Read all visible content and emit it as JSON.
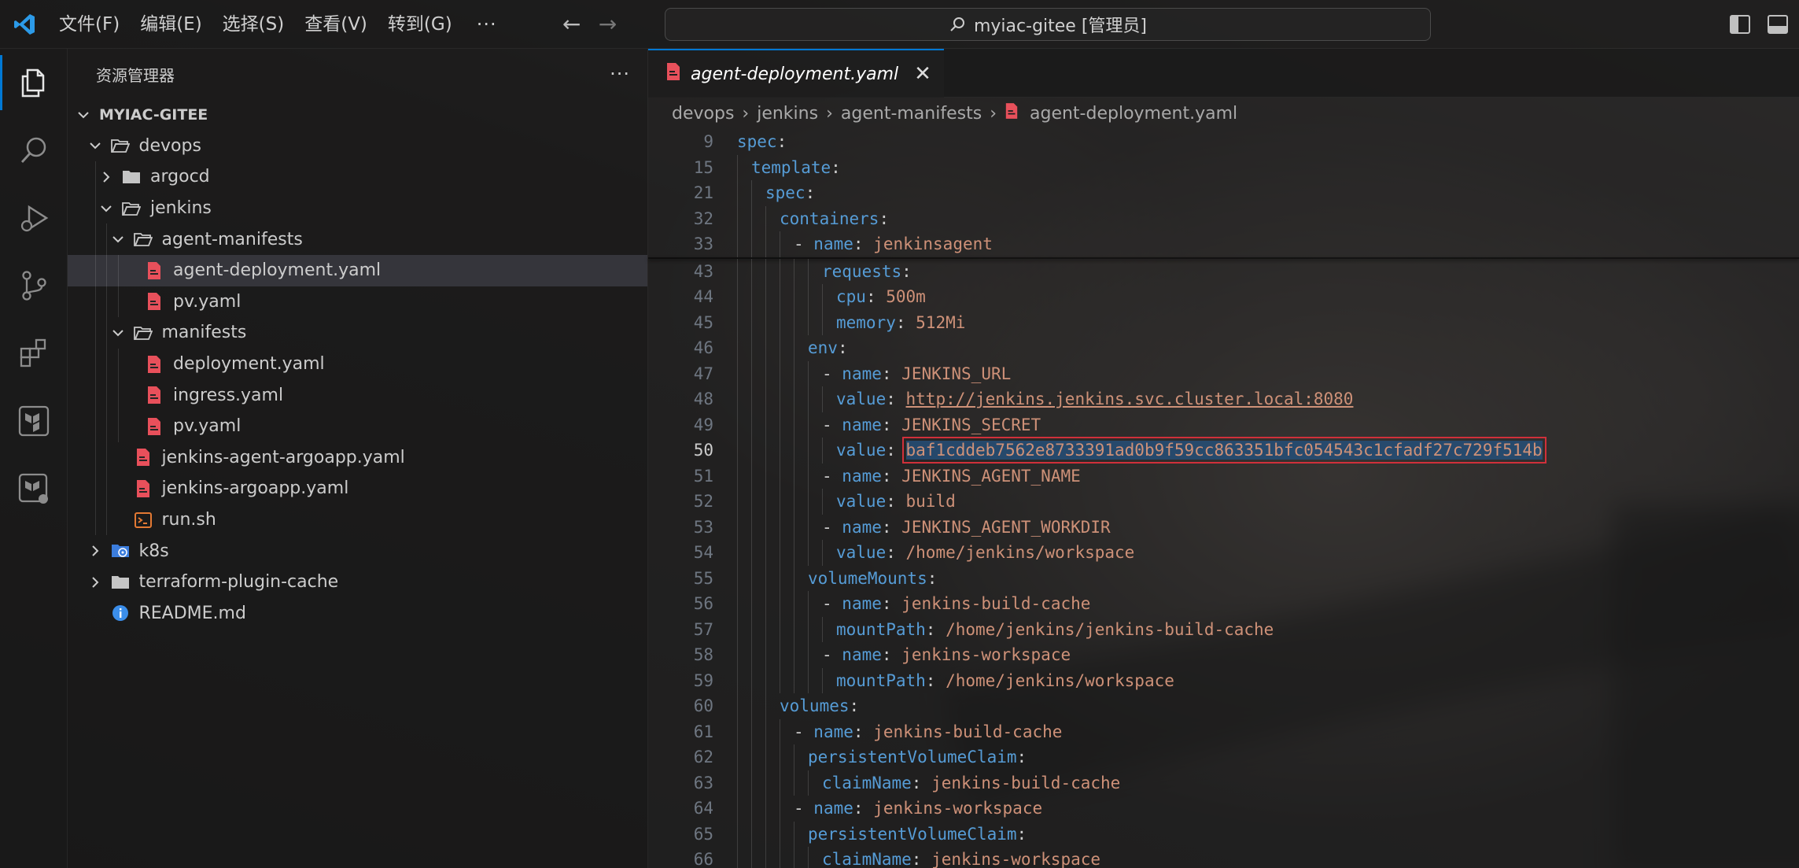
{
  "titlebar": {
    "menus": [
      "文件(F)",
      "编辑(E)",
      "选择(S)",
      "查看(V)",
      "转到(G)"
    ],
    "more": "···",
    "command_center": "myiac-gitee [管理员]"
  },
  "activitybar": {
    "items": [
      "explorer-icon",
      "search-icon",
      "run-debug-icon",
      "source-control-icon",
      "extensions-icon",
      "terraform-icon",
      "terraform-cloud-icon"
    ]
  },
  "sidebar": {
    "title": "资源管理器",
    "more": "···",
    "root": "MYIAC-GITEE",
    "tree": [
      {
        "label": "devops",
        "type": "folder-open",
        "depth": 1
      },
      {
        "label": "argocd",
        "type": "folder",
        "depth": 2
      },
      {
        "label": "jenkins",
        "type": "folder-open",
        "depth": 2
      },
      {
        "label": "agent-manifests",
        "type": "folder-open",
        "depth": 3
      },
      {
        "label": "agent-deployment.yaml",
        "type": "yaml",
        "depth": 4,
        "selected": true
      },
      {
        "label": "pv.yaml",
        "type": "yaml",
        "depth": 4
      },
      {
        "label": "manifests",
        "type": "folder-open",
        "depth": 3
      },
      {
        "label": "deployment.yaml",
        "type": "yaml",
        "depth": 4
      },
      {
        "label": "ingress.yaml",
        "type": "yaml",
        "depth": 4
      },
      {
        "label": "pv.yaml",
        "type": "yaml",
        "depth": 4
      },
      {
        "label": "jenkins-agent-argoapp.yaml",
        "type": "yaml",
        "depth": 3
      },
      {
        "label": "jenkins-argoapp.yaml",
        "type": "yaml",
        "depth": 3
      },
      {
        "label": "run.sh",
        "type": "shell",
        "depth": 3
      },
      {
        "label": "k8s",
        "type": "k8s-folder",
        "depth": 1
      },
      {
        "label": "terraform-plugin-cache",
        "type": "folder",
        "depth": 1
      },
      {
        "label": "README.md",
        "type": "info",
        "depth": 1
      }
    ]
  },
  "editor": {
    "tab": {
      "label": "agent-deployment.yaml",
      "close": "✕"
    },
    "breadcrumb": [
      "devops",
      "jenkins",
      "agent-manifests",
      "agent-deployment.yaml"
    ],
    "sticky_lines": [
      {
        "n": "9",
        "indent": 0,
        "tokens": [
          [
            "k",
            "spec"
          ],
          [
            "p",
            ":"
          ]
        ]
      },
      {
        "n": "15",
        "indent": 1,
        "tokens": [
          [
            "k",
            "template"
          ],
          [
            "p",
            ":"
          ]
        ]
      },
      {
        "n": "21",
        "indent": 2,
        "tokens": [
          [
            "k",
            "spec"
          ],
          [
            "p",
            ":"
          ]
        ]
      },
      {
        "n": "32",
        "indent": 3,
        "tokens": [
          [
            "k",
            "containers"
          ],
          [
            "p",
            ":"
          ]
        ]
      },
      {
        "n": "33",
        "indent": 4,
        "tokens": [
          [
            "p",
            "- "
          ],
          [
            "k",
            "name"
          ],
          [
            "p",
            ": "
          ],
          [
            "s",
            "jenkinsagent"
          ]
        ]
      }
    ],
    "lines": [
      {
        "n": "43",
        "indent": 6,
        "tokens": [
          [
            "k",
            "requests"
          ],
          [
            "p",
            ":"
          ]
        ]
      },
      {
        "n": "44",
        "indent": 7,
        "tokens": [
          [
            "k",
            "cpu"
          ],
          [
            "p",
            ": "
          ],
          [
            "s",
            "500m"
          ]
        ]
      },
      {
        "n": "45",
        "indent": 7,
        "tokens": [
          [
            "k",
            "memory"
          ],
          [
            "p",
            ": "
          ],
          [
            "s",
            "512Mi"
          ]
        ]
      },
      {
        "n": "46",
        "indent": 5,
        "tokens": [
          [
            "k",
            "env"
          ],
          [
            "p",
            ":"
          ]
        ]
      },
      {
        "n": "47",
        "indent": 6,
        "tokens": [
          [
            "p",
            "- "
          ],
          [
            "k",
            "name"
          ],
          [
            "p",
            ": "
          ],
          [
            "s",
            "JENKINS_URL"
          ]
        ]
      },
      {
        "n": "48",
        "indent": 7,
        "tokens": [
          [
            "k",
            "value"
          ],
          [
            "p",
            ": "
          ],
          [
            "link",
            "http://jenkins.jenkins.svc.cluster.local:8080"
          ]
        ]
      },
      {
        "n": "49",
        "indent": 6,
        "tokens": [
          [
            "p",
            "- "
          ],
          [
            "k",
            "name"
          ],
          [
            "p",
            ": "
          ],
          [
            "s",
            "JENKINS_SECRET"
          ]
        ]
      },
      {
        "n": "50",
        "indent": 7,
        "current": true,
        "tokens": [
          [
            "k",
            "value"
          ],
          [
            "p",
            ": "
          ],
          [
            "hl",
            "baf1cddeb7562e8733391ad0b9f59cc863351bfc054543c1cfadf27c729f514b"
          ]
        ]
      },
      {
        "n": "51",
        "indent": 6,
        "tokens": [
          [
            "p",
            "- "
          ],
          [
            "k",
            "name"
          ],
          [
            "p",
            ": "
          ],
          [
            "s",
            "JENKINS_AGENT_NAME"
          ]
        ]
      },
      {
        "n": "52",
        "indent": 7,
        "tokens": [
          [
            "k",
            "value"
          ],
          [
            "p",
            ": "
          ],
          [
            "s",
            "build"
          ]
        ]
      },
      {
        "n": "53",
        "indent": 6,
        "tokens": [
          [
            "p",
            "- "
          ],
          [
            "k",
            "name"
          ],
          [
            "p",
            ": "
          ],
          [
            "s",
            "JENKINS_AGENT_WORKDIR"
          ]
        ]
      },
      {
        "n": "54",
        "indent": 7,
        "tokens": [
          [
            "k",
            "value"
          ],
          [
            "p",
            ": "
          ],
          [
            "s",
            "/home/jenkins/workspace"
          ]
        ]
      },
      {
        "n": "55",
        "indent": 5,
        "tokens": [
          [
            "k",
            "volumeMounts"
          ],
          [
            "p",
            ":"
          ]
        ]
      },
      {
        "n": "56",
        "indent": 6,
        "tokens": [
          [
            "p",
            "- "
          ],
          [
            "k",
            "name"
          ],
          [
            "p",
            ": "
          ],
          [
            "s",
            "jenkins-build-cache"
          ]
        ]
      },
      {
        "n": "57",
        "indent": 7,
        "tokens": [
          [
            "k",
            "mountPath"
          ],
          [
            "p",
            ": "
          ],
          [
            "s",
            "/home/jenkins/jenkins-build-cache"
          ]
        ]
      },
      {
        "n": "58",
        "indent": 6,
        "tokens": [
          [
            "p",
            "- "
          ],
          [
            "k",
            "name"
          ],
          [
            "p",
            ": "
          ],
          [
            "s",
            "jenkins-workspace"
          ]
        ]
      },
      {
        "n": "59",
        "indent": 7,
        "tokens": [
          [
            "k",
            "mountPath"
          ],
          [
            "p",
            ": "
          ],
          [
            "s",
            "/home/jenkins/workspace"
          ]
        ]
      },
      {
        "n": "60",
        "indent": 3,
        "tokens": [
          [
            "k",
            "volumes"
          ],
          [
            "p",
            ":"
          ]
        ]
      },
      {
        "n": "61",
        "indent": 4,
        "tokens": [
          [
            "p",
            "- "
          ],
          [
            "k",
            "name"
          ],
          [
            "p",
            ": "
          ],
          [
            "s",
            "jenkins-build-cache"
          ]
        ]
      },
      {
        "n": "62",
        "indent": 5,
        "tokens": [
          [
            "k",
            "persistentVolumeClaim"
          ],
          [
            "p",
            ":"
          ]
        ]
      },
      {
        "n": "63",
        "indent": 6,
        "tokens": [
          [
            "k",
            "claimName"
          ],
          [
            "p",
            ": "
          ],
          [
            "s",
            "jenkins-build-cache"
          ]
        ]
      },
      {
        "n": "64",
        "indent": 4,
        "tokens": [
          [
            "p",
            "- "
          ],
          [
            "k",
            "name"
          ],
          [
            "p",
            ": "
          ],
          [
            "s",
            "jenkins-workspace"
          ]
        ]
      },
      {
        "n": "65",
        "indent": 5,
        "tokens": [
          [
            "k",
            "persistentVolumeClaim"
          ],
          [
            "p",
            ":"
          ]
        ]
      },
      {
        "n": "66",
        "indent": 6,
        "tokens": [
          [
            "k",
            "claimName"
          ],
          [
            "p",
            ": "
          ],
          [
            "s",
            "jenkins-workspace"
          ]
        ]
      }
    ]
  },
  "colors": {
    "accent": "#0078d4",
    "keyword": "#569cd6",
    "string": "#ce9178",
    "yaml_icon": "#e8505b",
    "highlight_border": "#d0303a"
  }
}
